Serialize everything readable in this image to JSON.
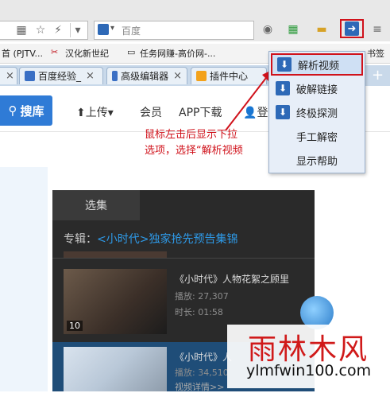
{
  "toolbar": {
    "search_placeholder": "百度",
    "url_fragment": ""
  },
  "bookmarks": [
    {
      "label": "首 (PJTV..."
    },
    {
      "label": "汉化新世纪"
    },
    {
      "label": "任务网赚-高价网-..."
    },
    {
      "label": "书签"
    }
  ],
  "tabs": [
    {
      "label": "...",
      "icon_color": "#3a6fc4"
    },
    {
      "label": "百度经验_",
      "icon_color": "#3a6fc4"
    },
    {
      "label": "高级编辑器",
      "icon_color": "#3a6fc4"
    },
    {
      "label": "插件中心",
      "icon_color": "#f3a21b"
    }
  ],
  "page": {
    "search_button": "搜库",
    "nav": {
      "upload": "上传",
      "member": "会员",
      "app": "APP下载",
      "login": "登"
    },
    "episodes_tab": "选集",
    "album_prefix": "专辑：",
    "album_title": "<小时代>独家抢先预告集锦",
    "videos": [
      {
        "title": "《小时代》人物花絮之顾里",
        "plays": "播放: 27,307",
        "duration": "时长: 01:58",
        "badge": "10"
      },
      {
        "title": "《小时代》人",
        "plays": "播放: 34,510",
        "duration": "视频详情>>",
        "badge": ""
      }
    ]
  },
  "dropdown": {
    "items": [
      {
        "label": "解析视频",
        "has_icon": true
      },
      {
        "label": "破解链接",
        "has_icon": true
      },
      {
        "label": "终极探测",
        "has_icon": true
      },
      {
        "label": "手工解密",
        "has_icon": false
      },
      {
        "label": "显示帮助",
        "has_icon": false
      }
    ]
  },
  "annotation": {
    "line1": "鼠标左击后显示下拉",
    "line2": "选项，选择“解析视频"
  },
  "watermark": {
    "cn": "雨林木风",
    "en": "ylmfwin100.com"
  },
  "colors": {
    "accent_red": "#d0121b",
    "blue": "#2e69b7"
  }
}
